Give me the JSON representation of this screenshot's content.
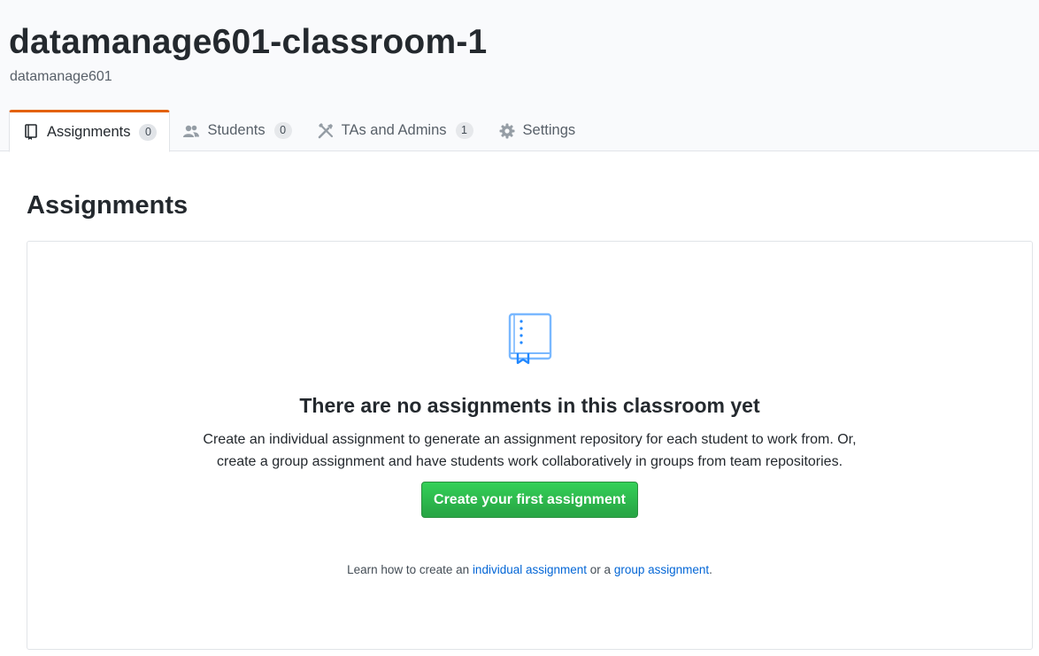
{
  "header": {
    "classroom_title": "datamanage601-classroom-1",
    "org_name": "datamanage601"
  },
  "tabs": [
    {
      "label": "Assignments",
      "count": "0",
      "icon": "book-icon",
      "selected": true
    },
    {
      "label": "Students",
      "count": "0",
      "icon": "people-icon",
      "selected": false
    },
    {
      "label": "TAs and Admins",
      "count": "1",
      "icon": "tools-icon",
      "selected": false
    },
    {
      "label": "Settings",
      "count": null,
      "icon": "gear-icon",
      "selected": false
    }
  ],
  "main": {
    "section_title": "Assignments",
    "blankslate": {
      "icon": "notebook-icon",
      "heading": "There are no assignments in this classroom yet",
      "description_line1": "Create an individual assignment to generate an assignment repository for each student to work from. Or,",
      "description_line2": "create a group assignment and have students work collaboratively in groups from team repositories.",
      "button_label": "Create your first assignment",
      "learn_prefix": "Learn how to create an",
      "learn_link_individual": "individual assignment",
      "learn_middle": "or a",
      "learn_link_group": "group assignment",
      "learn_suffix": "."
    }
  },
  "colors": {
    "accent_tab": "#e36209",
    "button_green": "#28a745",
    "link_blue": "#0366d6",
    "icon_blue": "#79b8ff"
  }
}
